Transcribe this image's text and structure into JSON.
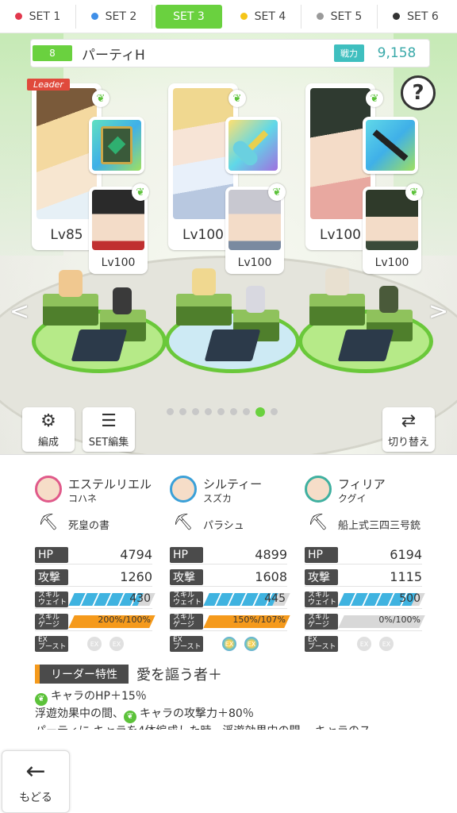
{
  "tabs": [
    {
      "label": "SET 1",
      "color": "#e2384d"
    },
    {
      "label": "SET 2",
      "color": "#3f8fe8"
    },
    {
      "label": "SET 3",
      "color": "#6ad13f"
    },
    {
      "label": "SET 4",
      "color": "#f5c518"
    },
    {
      "label": "SET 5",
      "color": "#9a9a9a"
    },
    {
      "label": "SET 6",
      "color": "#333333"
    }
  ],
  "party": {
    "number": "8",
    "name": "パーティH",
    "power_label": "戦力",
    "power": "9,158"
  },
  "help": "?",
  "leader_badge": "Leader",
  "slots": [
    {
      "main_lv": "Lv85",
      "sub_lv": "Lv100"
    },
    {
      "main_lv": "Lv100",
      "sub_lv": "Lv100"
    },
    {
      "main_lv": "Lv100",
      "sub_lv": "Lv100"
    }
  ],
  "buttons": {
    "edit": "編成",
    "set_edit": "SET編集",
    "switch": "切り替え",
    "back": "もどる"
  },
  "page_dots": {
    "count": 9,
    "active": 7
  },
  "characters": [
    {
      "name": "エステルリエル",
      "sub": "コハネ",
      "weapon": "死皇の書",
      "hp": "4794",
      "atk": "1260",
      "skill_wait": "430",
      "skill_gauge": "200%/100%",
      "skill_wait_fill": 0.85,
      "skill_gauge_fill": 1.0,
      "ex_on": false
    },
    {
      "name": "シルティー",
      "sub": "スズカ",
      "weapon": "パラシュ",
      "hp": "4899",
      "atk": "1608",
      "skill_wait": "445",
      "skill_gauge": "150%/107%",
      "skill_wait_fill": 0.85,
      "skill_gauge_fill": 1.0,
      "ex_on": true
    },
    {
      "name": "フィリア",
      "sub": "クグイ",
      "weapon": "船上式三四三号銃",
      "hp": "6194",
      "atk": "1115",
      "skill_wait": "500",
      "skill_gauge": "0%/100%",
      "skill_wait_fill": 0.9,
      "skill_gauge_fill": 0.0,
      "ex_on": false
    }
  ],
  "stat_labels": {
    "hp": "HP",
    "atk": "攻撃",
    "skill_wait": [
      "スキル",
      "ウェイト"
    ],
    "skill_gauge": [
      "スキル",
      "ゲージ"
    ],
    "ex_boost": [
      "EX",
      "ブースト"
    ],
    "ex": "EX"
  },
  "leader": {
    "tag": "リーダー特性",
    "name": "愛を謳う者＋",
    "line1": "キャラのHP＋15％",
    "line2a": "浮遊効果中の間、",
    "line2b": "キャラの攻撃力＋80％",
    "line3": "パーティに キャラを4体編成した時、浮遊効果中の間、 キャラのス"
  },
  "colors": {
    "accent": "#6ad13f",
    "skill_wait": "#3fb3e0",
    "skill_gauge": "#f59a1c",
    "teal": "#3fbfbf"
  }
}
